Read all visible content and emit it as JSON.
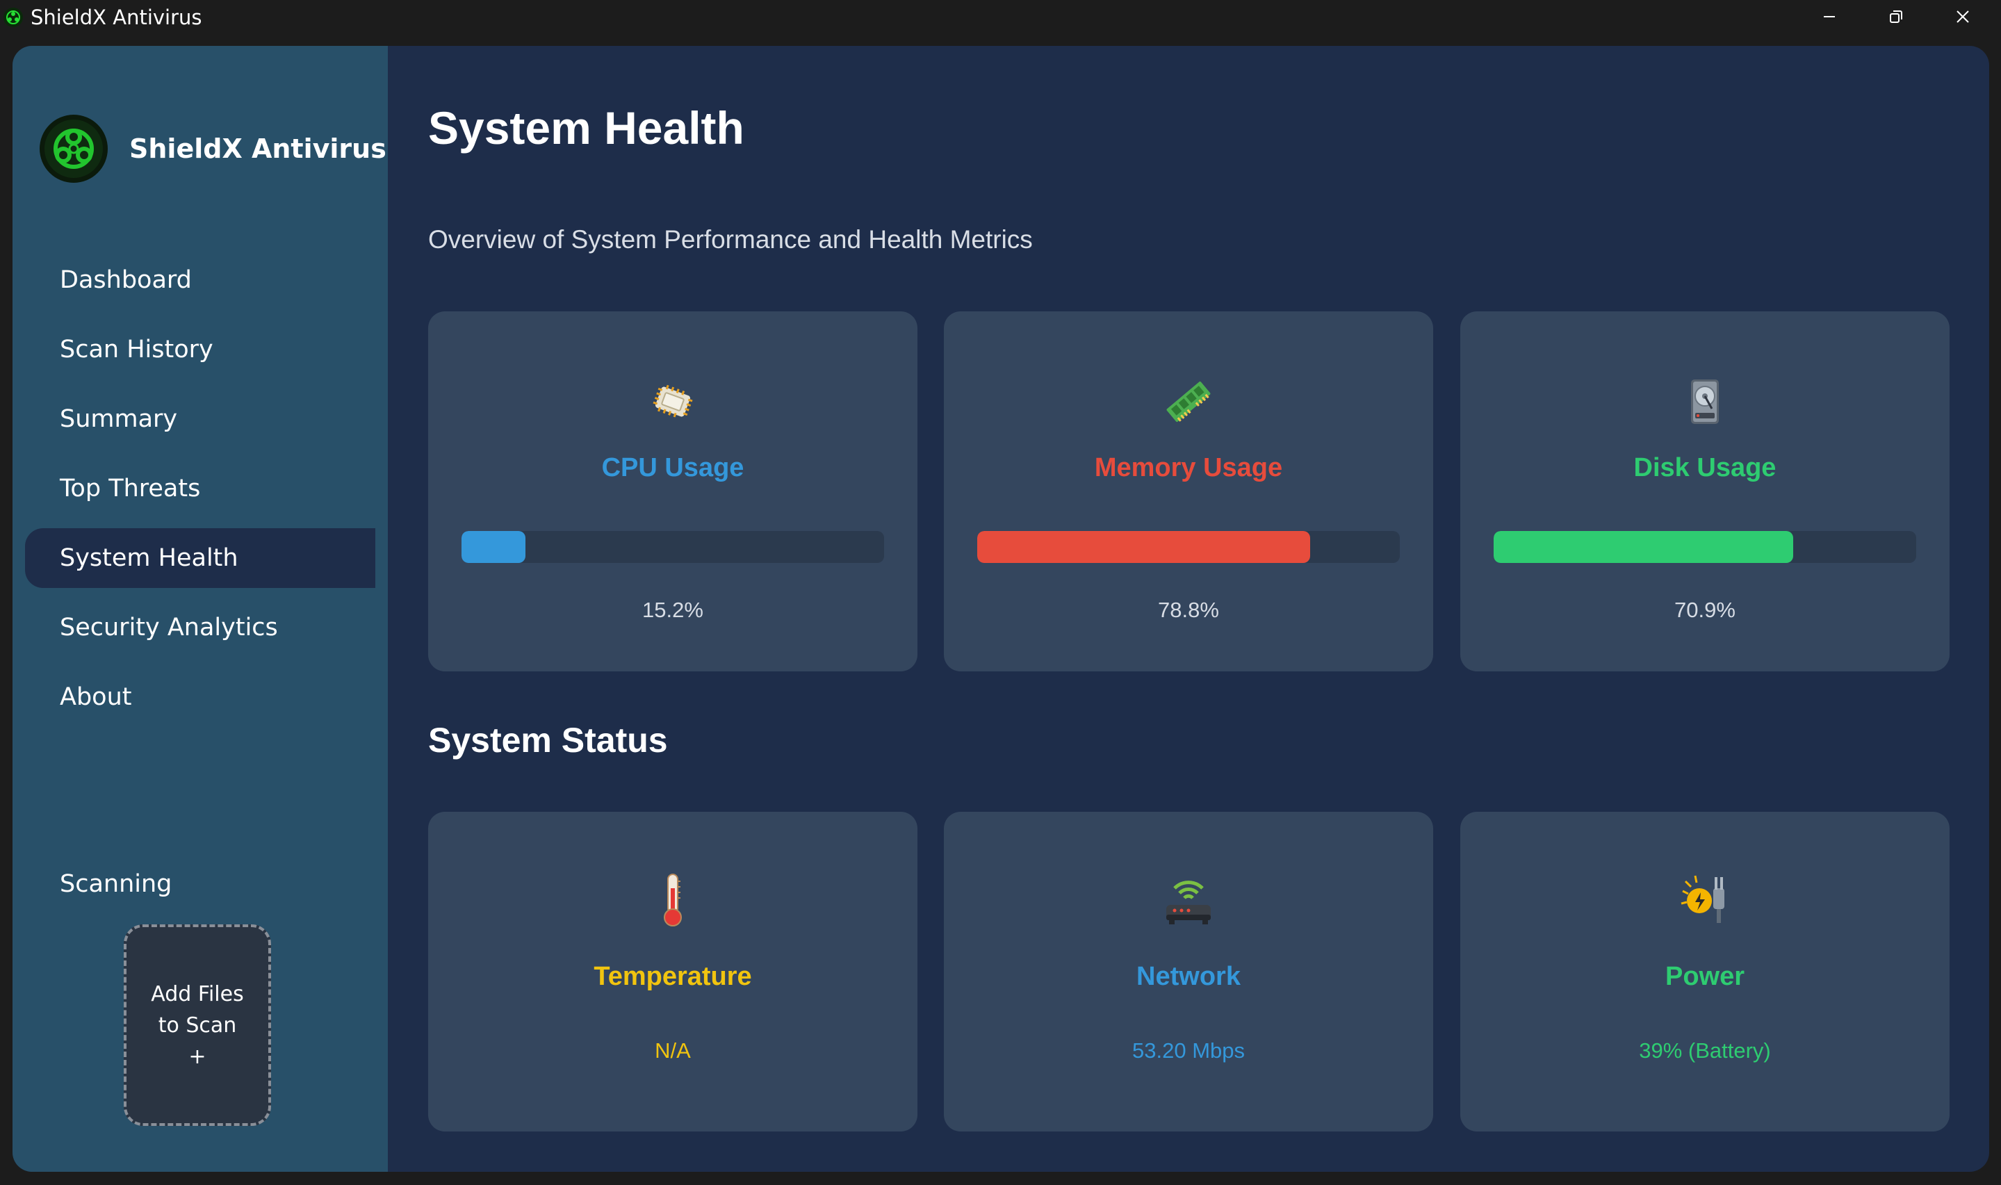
{
  "window": {
    "title": "ShieldX Antivirus"
  },
  "sidebar": {
    "brand": "ShieldX Antivirus",
    "items": [
      {
        "label": "Dashboard",
        "active": false
      },
      {
        "label": "Scan History",
        "active": false
      },
      {
        "label": "Summary",
        "active": false
      },
      {
        "label": "Top Threats",
        "active": false
      },
      {
        "label": "System Health",
        "active": true
      },
      {
        "label": "Security Analytics",
        "active": false
      },
      {
        "label": "About",
        "active": false
      }
    ],
    "scanning_label": "Scanning",
    "add_files": {
      "line1": "Add Files",
      "line2": "to Scan",
      "plus": "+"
    }
  },
  "main": {
    "title": "System Health",
    "subtitle": "Overview of System Performance and Health Metrics",
    "metrics": [
      {
        "label": "CPU Usage",
        "value_text": "15.2%",
        "percent": 15.2,
        "color": "#3498db",
        "icon": "cpu-chip-icon"
      },
      {
        "label": "Memory Usage",
        "value_text": "78.8%",
        "percent": 78.8,
        "color": "#e74c3c",
        "icon": "memory-ram-icon"
      },
      {
        "label": "Disk Usage",
        "value_text": "70.9%",
        "percent": 70.9,
        "color": "#2ecc71",
        "icon": "hard-disk-icon"
      }
    ],
    "status_title": "System Status",
    "status": [
      {
        "label": "Temperature",
        "value": "N/A",
        "color": "#f1c40f",
        "icon": "thermometer-icon"
      },
      {
        "label": "Network",
        "value": "53.20 Mbps",
        "color": "#3498db",
        "icon": "wifi-router-icon"
      },
      {
        "label": "Power",
        "value": "39% (Battery)",
        "color": "#2ecc71",
        "icon": "power-plug-icon"
      }
    ]
  }
}
